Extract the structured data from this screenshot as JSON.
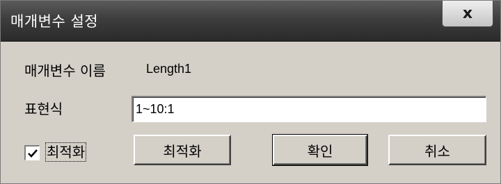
{
  "window": {
    "title": "매개변수 설정",
    "close_glyph": "x"
  },
  "form": {
    "param_name_label": "매개변수 이름",
    "param_name_value": "Length1",
    "expression_label": "표현식",
    "expression_value": "1~10:1",
    "optimize_checkbox": {
      "label": "최적화",
      "checked": true
    }
  },
  "buttons": {
    "optimize": "최적화",
    "ok": "확인",
    "cancel": "취소"
  }
}
